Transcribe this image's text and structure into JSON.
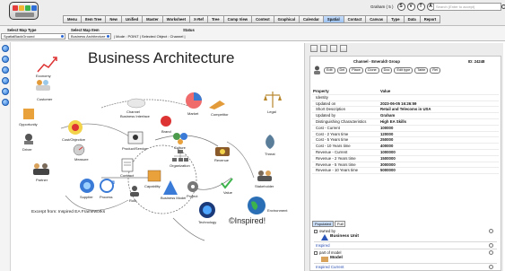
{
  "header": {
    "nav_tabs": [
      {
        "label": "Menu"
      },
      {
        "label": "Item Tree"
      },
      {
        "label": "New"
      },
      {
        "label": "Unified"
      },
      {
        "label": "Master"
      },
      {
        "label": "Worksheet"
      },
      {
        "label": "X-Ref"
      },
      {
        "label": "Tree"
      },
      {
        "label": "Comp View"
      },
      {
        "label": "Context"
      },
      {
        "label": "Graphical"
      },
      {
        "label": "Calendar"
      },
      {
        "label": "Spatial",
        "active": true
      },
      {
        "label": "Contact"
      },
      {
        "label": "Canvas"
      },
      {
        "label": "Type"
      },
      {
        "label": "Data"
      },
      {
        "label": "Report"
      }
    ],
    "user_name": "Graham ( 5 )",
    "round_buttons": [
      "S",
      "V",
      "T",
      "A",
      "O",
      "X"
    ],
    "search_placeholder": "Search (Enter to accept)"
  },
  "subheader": {
    "map_type_label": "Select Map Type",
    "map_type_value": "SpatialBackGround",
    "map_item_label": "Select Map Item",
    "map_item_value": "Business Architecture",
    "status_label": "Status",
    "status_text": "| Mode : POINT | Selected Object : Channel |"
  },
  "diagram": {
    "title": "Business Architecture",
    "caption": "Excerpt from: Inspired EA Frameworks",
    "copyright": "©Inspired!",
    "nodes": [
      "Economy",
      "Channel",
      "Business Interface",
      "Market",
      "Competitor",
      "Legal",
      "Customer",
      "Brand",
      "Opportunity",
      "Cost/Objective",
      "Product/Service",
      "Culture",
      "Threat",
      "Driver",
      "Measure",
      "Contract",
      "Organization",
      "Revenue",
      "Capability",
      "Stakeholder",
      "Value",
      "Process",
      "Business Model",
      "Project",
      "Partner",
      "Role",
      "Supplier",
      "Environment",
      "Technology"
    ]
  },
  "panel": {
    "title": "Channel - Emerald! Group",
    "id_label": "ID: 24248",
    "actions": [
      "Edit",
      "Del",
      "Place",
      "Clone",
      "Doc",
      "Edit type",
      "Table",
      "Rel"
    ],
    "prop_header": {
      "key": "Property",
      "value": "Value"
    },
    "properties": [
      {
        "key": "Identity",
        "value": ""
      },
      {
        "key": "Updated on",
        "value": "2023-06-05 16:26:59"
      },
      {
        "key": "Short Description",
        "value": "Retail and Telecoms in USA"
      },
      {
        "key": "Updated by",
        "value": "Graham"
      },
      {
        "key": "Distinguishing Characteristics",
        "value": "High EA Skills"
      },
      {
        "key": "Cost - Current",
        "value": "100000"
      },
      {
        "key": "Cost - 2 Years time",
        "value": "120000"
      },
      {
        "key": "Cost - 5 Years time",
        "value": "250000"
      },
      {
        "key": "Cost - 10 Years time",
        "value": "400000"
      },
      {
        "key": "Revenue - Current",
        "value": "1000000"
      },
      {
        "key": "Revenue - 2 Years time",
        "value": "1500000"
      },
      {
        "key": "Revenue - 5 Years time",
        "value": "3000000"
      },
      {
        "key": "Revenue - 10 Years time",
        "value": "5000000"
      }
    ],
    "rel_tabs": [
      "Populated",
      "Full"
    ],
    "relations": {
      "owned_by_label": "owned by",
      "owned_by_object": "Business Unit",
      "owned_by_link": "Inspired",
      "part_of_label": "part of model",
      "part_of_object": "Model",
      "part_of_link": "Inspired Current"
    }
  }
}
